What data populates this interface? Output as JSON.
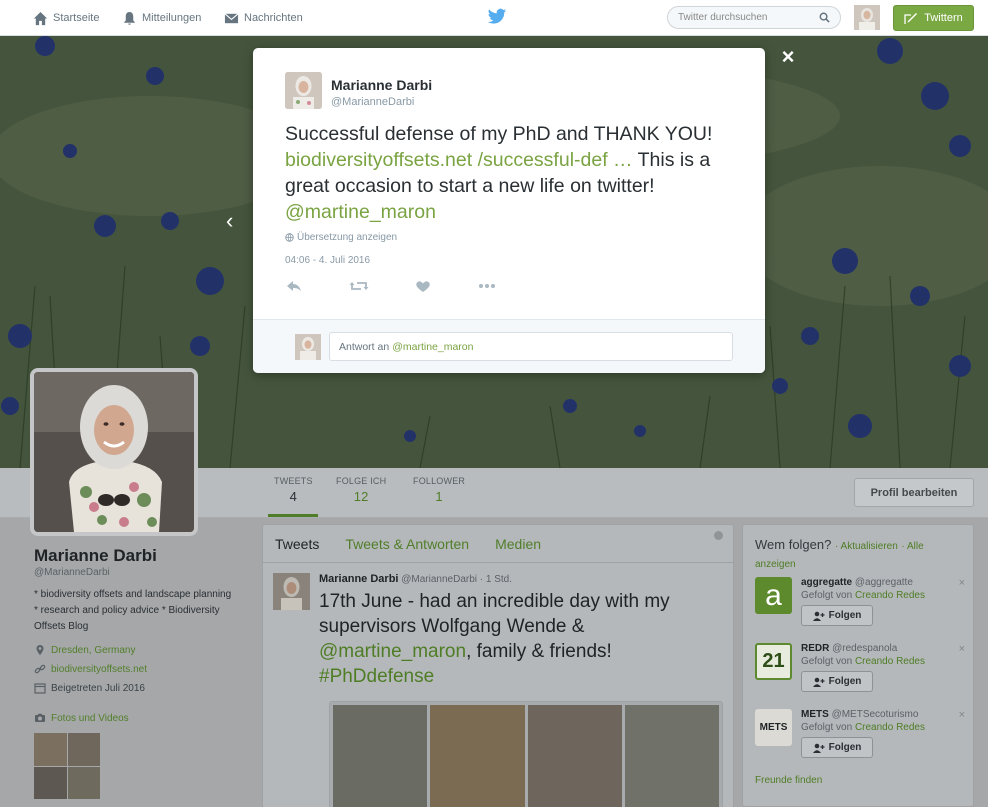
{
  "nav": {
    "home": "Startseite",
    "notifications": "Mitteilungen",
    "messages": "Nachrichten",
    "search_placeholder": "Twitter durchsuchen",
    "tweet_button": "Twittern"
  },
  "modal": {
    "name": "Marianne Darbi",
    "handle": "@MarianneDarbi",
    "text_1": "Successful defense of my PhD and THANK YOU! ",
    "link": "biodiversityoffsets.net /successful-def …",
    "text_2": " This is a great occasion to start a new life on twitter! ",
    "mention": "@martine_maron",
    "translate": "Übersetzung anzeigen",
    "timestamp": "04:06 - 4. Juli 2016",
    "reply_prefix": "Antwort an",
    "reply_mention": "@martine_maron",
    "close": "×"
  },
  "profile": {
    "name": "Marianne Darbi",
    "handle": "@MarianneDarbi",
    "bio": "* biodiversity offsets and landscape planning * research and policy advice * Biodiversity Offsets Blog",
    "location": "Dresden, Germany",
    "website": "biodiversityoffsets.net",
    "joined": "Beigetreten Juli 2016",
    "photos_label": "Fotos und Videos",
    "edit_button": "Profil bearbeiten"
  },
  "stats": [
    {
      "label": "TWEETS",
      "value": "4"
    },
    {
      "label": "FOLGE ICH",
      "value": "12"
    },
    {
      "label": "FOLLOWER",
      "value": "1"
    }
  ],
  "timeline": {
    "tabs": [
      "Tweets",
      "Tweets & Antworten",
      "Medien"
    ],
    "tweet": {
      "name": "Marianne Darbi",
      "handle": "@MarianneDarbi",
      "time": "· 1 Std.",
      "text_1": "17th June - had an incredible day with my supervisors Wolfgang Wende & ",
      "mention": "@martine_maron",
      "text_2": ", family & friends! ",
      "hashtag": "#PhDdefense"
    }
  },
  "who_to_follow": {
    "title": "Wem folgen?",
    "refresh": "· Aktualisieren",
    "show_all": "· Alle anzeigen",
    "followed_by_prefix": "Gefolgt von",
    "follow_label": "Folgen",
    "find_friends": "Freunde finden",
    "items": [
      {
        "name": "aggregatte",
        "handle": "@aggregatte",
        "followed_by": "Creando Redes",
        "icon": "a"
      },
      {
        "name": "REDR",
        "handle": "@redespanola",
        "followed_by": "Creando Redes",
        "icon": "21"
      },
      {
        "name": "METS",
        "handle": "@METSecoturismo",
        "followed_by": "Creando Redes",
        "icon": "METS"
      }
    ]
  },
  "colors": {
    "accent": "#7aa342",
    "link_dim": "#4e7d26"
  }
}
